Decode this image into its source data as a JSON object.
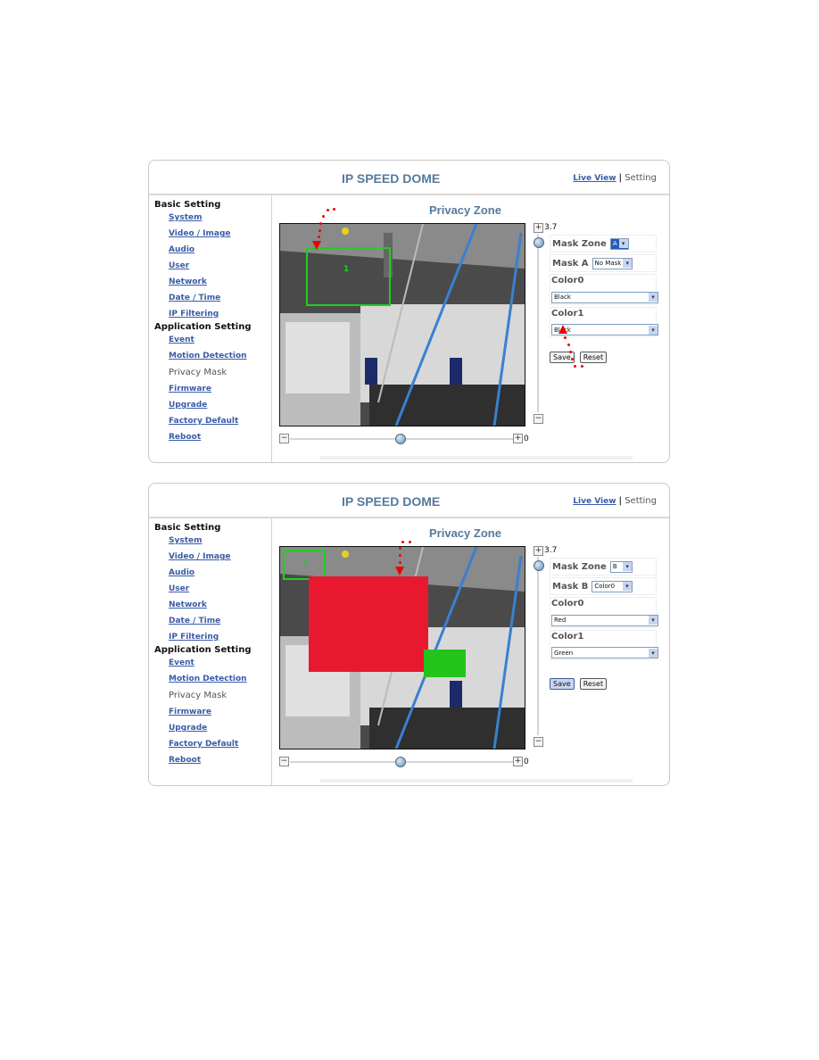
{
  "panels": [
    {
      "header": {
        "title": "IP SPEED DOME",
        "live_view": "Live View",
        "separator": "|",
        "setting": "Setting"
      },
      "sidebar": {
        "basic_heading": "Basic Setting",
        "basic_items": [
          "System",
          "Video / Image",
          "Audio",
          "User",
          "Network",
          "Date / Time",
          "IP Filtering"
        ],
        "app_heading": "Application Setting",
        "app_items": [
          "Event",
          "Motion Detection",
          "Privacy Mask",
          "Firmware",
          "Upgrade",
          "Factory Default",
          "Reboot"
        ],
        "current": "Privacy Mask"
      },
      "page_title": "Privacy Zone",
      "zoom_value": "3.7",
      "pan_value": "0",
      "controls": {
        "mask_zone_label": "Mask Zone",
        "mask_zone_value": "A",
        "mask_label": "Mask A",
        "mask_value": "No Mask",
        "color0_label": "Color0",
        "color0_value": "Black",
        "color1_label": "Color1",
        "color1_value": "Black",
        "save": "Save",
        "reset": "Reset"
      },
      "overlay": {
        "zone_label": "1",
        "zone_color": "#22cc22"
      }
    },
    {
      "header": {
        "title": "IP SPEED DOME",
        "live_view": "Live View",
        "separator": "|",
        "setting": "Setting"
      },
      "sidebar": {
        "basic_heading": "Basic Setting",
        "basic_items": [
          "System",
          "Video / Image",
          "Audio",
          "User",
          "Network",
          "Date / Time",
          "IP Filtering"
        ],
        "app_heading": "Application Setting",
        "app_items": [
          "Event",
          "Motion Detection",
          "Privacy Mask",
          "Firmware",
          "Upgrade",
          "Factory Default",
          "Reboot"
        ],
        "current": "Privacy Mask"
      },
      "page_title": "Privacy Zone",
      "zoom_value": "3.7",
      "pan_value": "0",
      "controls": {
        "mask_zone_label": "Mask Zone",
        "mask_zone_value": "B",
        "mask_label": "Mask B",
        "mask_value": "Color0",
        "color0_label": "Color0",
        "color0_value": "Red",
        "color1_label": "Color1",
        "color1_value": "Green",
        "save": "Save",
        "reset": "Reset"
      },
      "overlay": {
        "zone_label": "1",
        "zone_color": "#22cc22",
        "mask_color0": "#e8192f",
        "mask_color1": "#22c41a"
      }
    }
  ]
}
